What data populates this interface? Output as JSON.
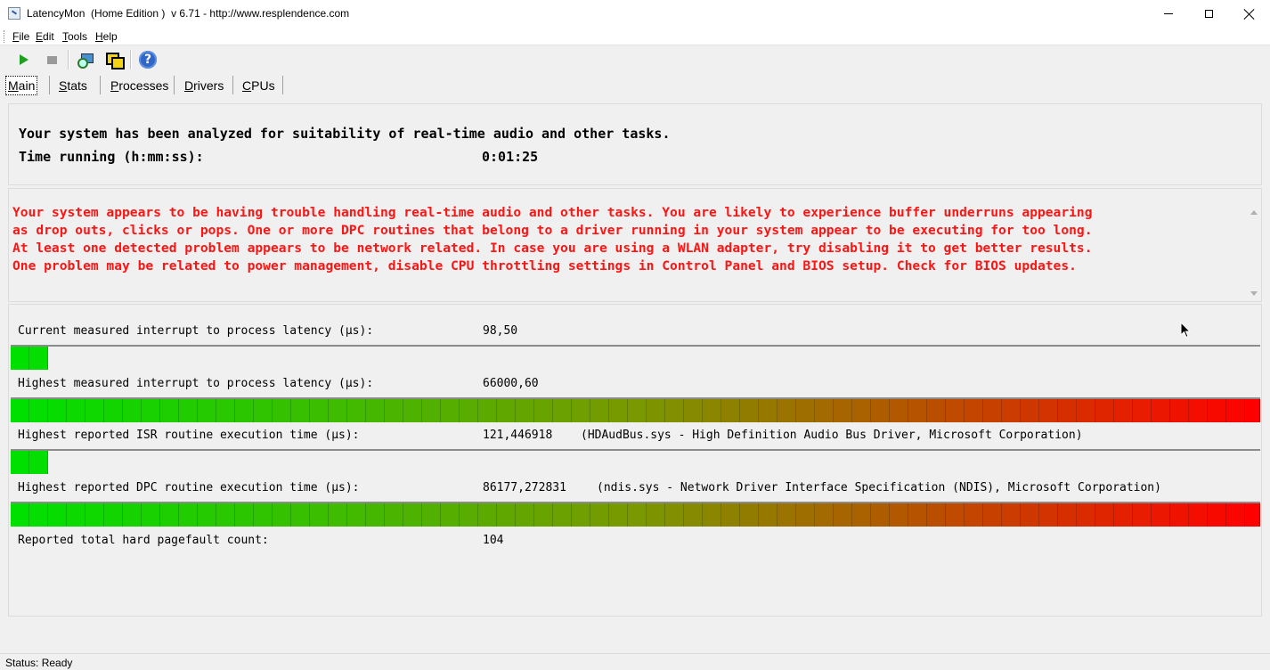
{
  "window": {
    "title": "LatencyMon  (Home Edition )  v 6.71 - http://www.resplendence.com"
  },
  "menu": {
    "items": [
      "File",
      "Edit",
      "Tools",
      "Help"
    ]
  },
  "toolbar": {
    "buttons": [
      "play-icon",
      "stop-icon",
      "report-icon",
      "copy-icon",
      "help-icon"
    ]
  },
  "tabs": [
    "Main",
    "Stats",
    "Processes",
    "Drivers",
    "CPUs"
  ],
  "summary": {
    "headline": "Your system has been analyzed for suitability of real-time audio and other tasks.",
    "time_label": "Time running (h:mm:ss):",
    "time_value": "0:01:25"
  },
  "warning": {
    "lines": [
      "Your system appears to be having trouble handling real-time audio and other tasks. You are likely to experience buffer underruns appearing",
      "as drop outs, clicks or pops. One or more DPC routines that belong to a driver running in your system appear to be executing for too long.",
      "At least one detected problem appears to be network related. In case you are using a WLAN adapter, try disabling it to get better results.",
      "One problem may be related to power management, disable CPU throttling settings in Control Panel and BIOS setup. Check for BIOS updates."
    ],
    "color": "#ff1414"
  },
  "metrics": {
    "current": {
      "label": "Current measured interrupt to process latency (µs):",
      "value": "98,50",
      "level": 0.03
    },
    "highest": {
      "label": "Highest measured interrupt to process latency (µs):",
      "value": "66000,60",
      "level": 1.0
    },
    "isr": {
      "label": "Highest reported ISR routine execution time (µs):",
      "value": "121,446918",
      "driver": "(HDAudBus.sys - High Definition Audio Bus Driver, Microsoft Corporation)",
      "level": 0.03
    },
    "dpc": {
      "label": "Highest reported DPC routine execution time (µs):",
      "value": "86177,272831",
      "driver": "(ndis.sys - Network Driver Interface Specification (NDIS), Microsoft Corporation)",
      "level": 1.0
    },
    "pagefault": {
      "label": "Reported total hard pagefault count:",
      "value": "104"
    }
  },
  "colors": {
    "bar_start": "#00e000",
    "bar_end": "#ff0000"
  },
  "status": {
    "text": "Status: Ready"
  }
}
